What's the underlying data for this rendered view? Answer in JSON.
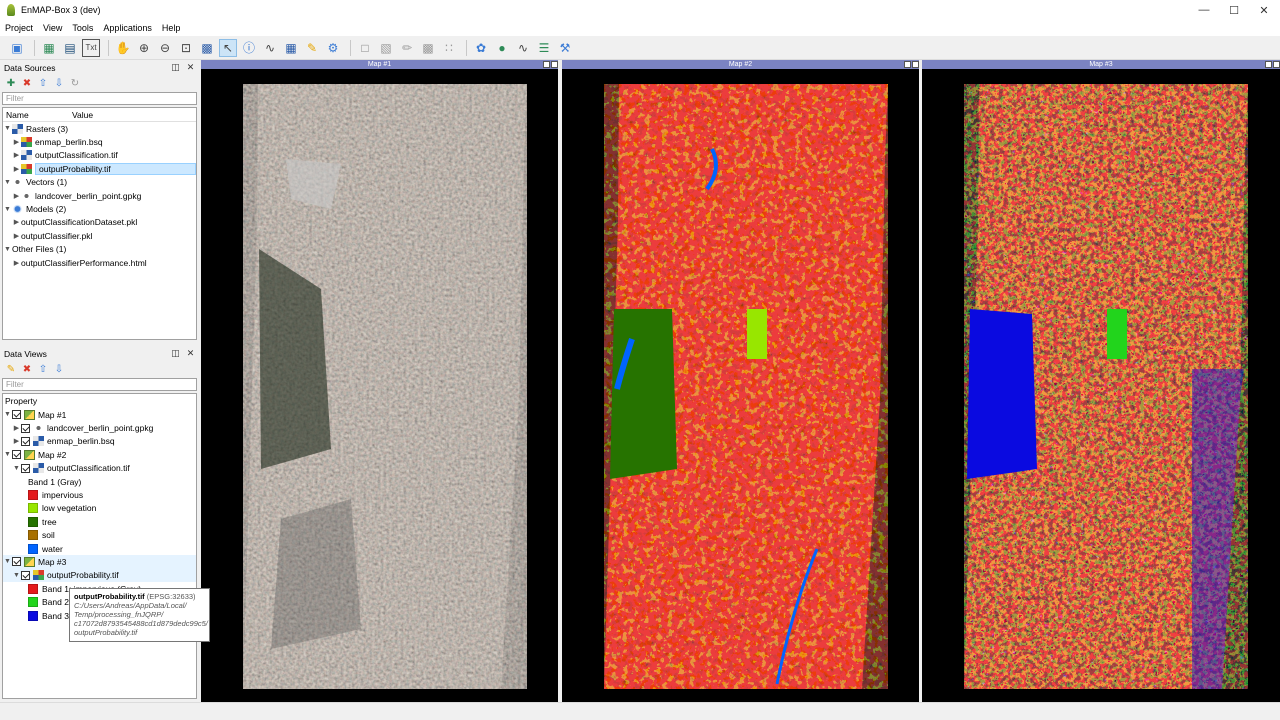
{
  "window": {
    "title": "EnMAP-Box 3 (dev)"
  },
  "menu": [
    "Project",
    "View",
    "Tools",
    "Applications",
    "Help"
  ],
  "data_sources": {
    "title": "Data Sources",
    "filter_placeholder": "Filter",
    "columns": [
      "Name",
      "Value"
    ],
    "groups": [
      {
        "label": "Rasters (3)",
        "items": [
          "enmap_berlin.bsq",
          "outputClassification.tif",
          "outputProbability.tif"
        ]
      },
      {
        "label": "Vectors (1)",
        "items": [
          "landcover_berlin_point.gpkg"
        ]
      },
      {
        "label": "Models (2)",
        "items": [
          "outputClassificationDataset.pkl",
          "outputClassifier.pkl"
        ]
      },
      {
        "label": "Other Files (1)",
        "items": [
          "outputClassifierPerformance.html"
        ]
      }
    ]
  },
  "data_views": {
    "title": "Data Views",
    "filter_placeholder": "Filter",
    "column": "Property",
    "map1": {
      "label": "Map #1",
      "layers": [
        "landcover_berlin_point.gpkg",
        "enmap_berlin.bsq"
      ]
    },
    "map2": {
      "label": "Map #2",
      "layer": "outputClassification.tif",
      "band": "Band 1 (Gray)",
      "classes": [
        {
          "label": "impervious",
          "color": "#e41a1c"
        },
        {
          "label": "low vegetation",
          "color": "#98e600"
        },
        {
          "label": "tree",
          "color": "#267300"
        },
        {
          "label": "soil",
          "color": "#a87000"
        },
        {
          "label": "water",
          "color": "#0064ff"
        }
      ]
    },
    "map3": {
      "label": "Map #3",
      "layer": "outputProbability.tif",
      "bands": [
        {
          "label": "Band 1: impervious (Gray)",
          "color": "#e41a1c"
        },
        {
          "label": "Band 2",
          "color": "#22d41c"
        },
        {
          "label": "Band 3",
          "color": "#0a0ae0"
        }
      ]
    }
  },
  "tooltip": {
    "name": "outputProbability.tif",
    "crs": "(EPSG:32633)",
    "lines": [
      "C:/Users/Andreas/AppData/Local/",
      "Temp/processing_fnJQRP/",
      "c17072d8793545488cd1d879dedc99c5/",
      "outputProbability.tif"
    ]
  },
  "maps": [
    {
      "title": "Map #1"
    },
    {
      "title": "Map #2"
    },
    {
      "title": "Map #3"
    }
  ],
  "toolbar_icons": [
    "add-data-source-icon",
    "new-map-icon",
    "new-spectral-library-icon",
    "new-text-view-icon",
    "pan-icon",
    "zoom-in-icon",
    "zoom-out-icon",
    "zoom-full-icon",
    "zoom-native-icon",
    "select-icon",
    "identify-icon",
    "spectral-profile-icon",
    "pixel-grid-icon",
    "link-icon",
    "settings-icon",
    "select-features-icon",
    "edit-icon",
    "save-edits-icon",
    "digitize-icon",
    "process-icon",
    "location-icon",
    "profile-icon",
    "layers-icon",
    "tools-icon"
  ]
}
